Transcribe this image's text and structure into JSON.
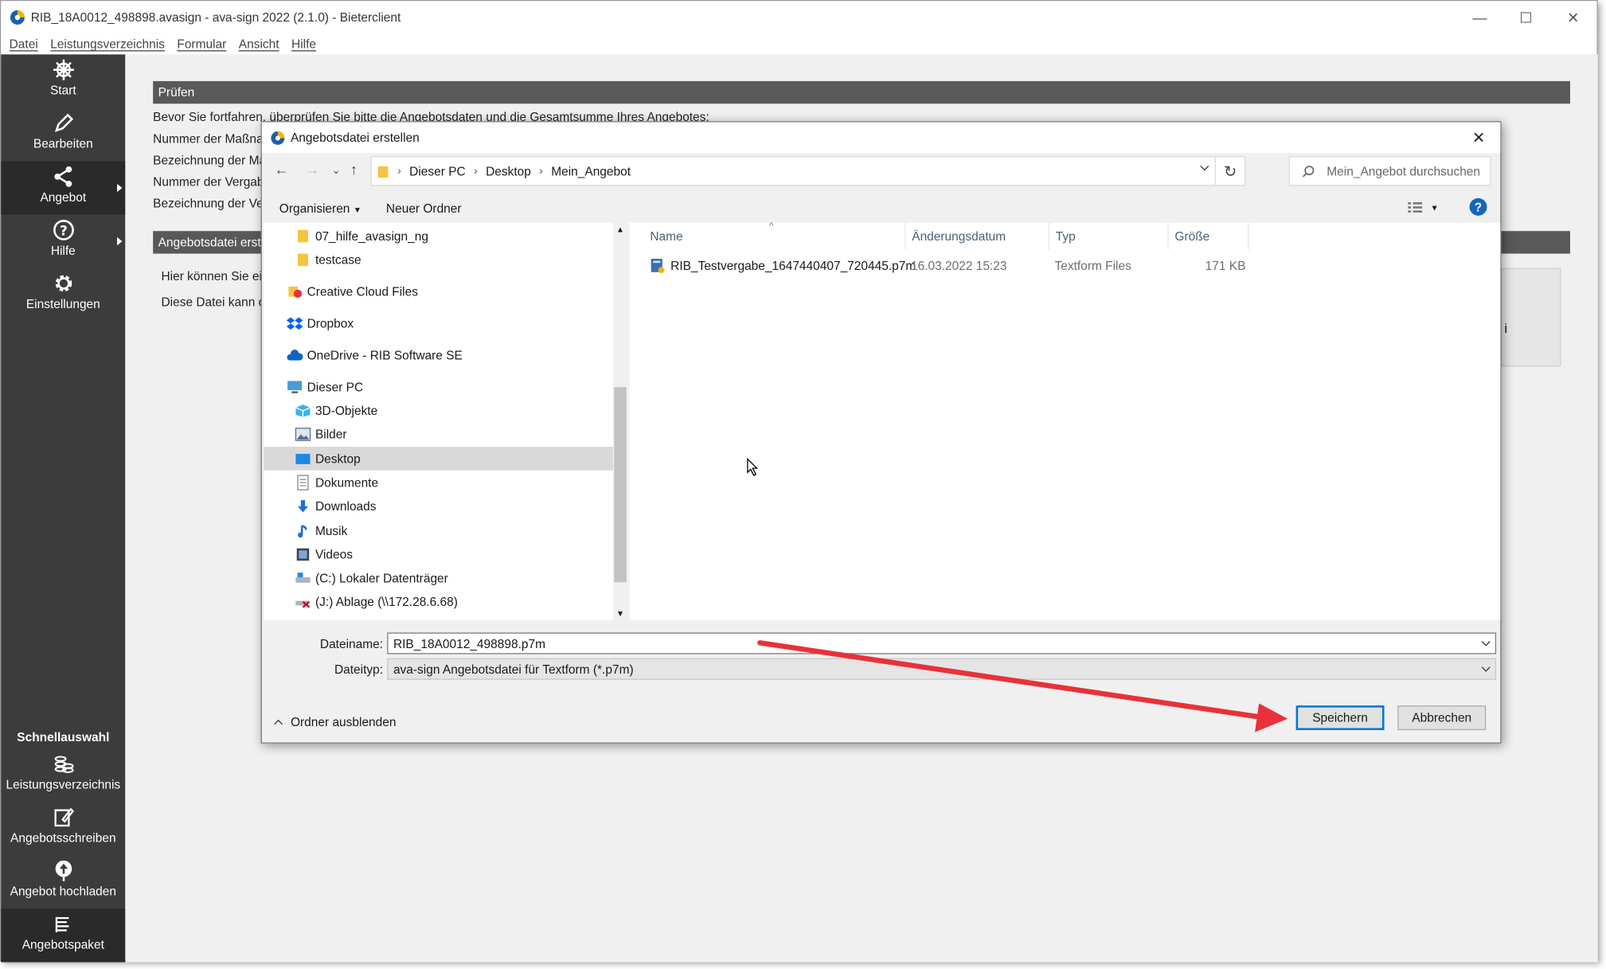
{
  "window": {
    "title": "RIB_18A0012_498898.avasign - ava-sign 2022 (2.1.0) - Bieterclient",
    "minimize": "—",
    "maximize": "☐",
    "close": "✕"
  },
  "menu": [
    "Datei",
    "Leistungsverzeichnis",
    "Formular",
    "Ansicht",
    "Hilfe"
  ],
  "sidebar": {
    "items": [
      {
        "label": "Start",
        "icon": "helm-icon"
      },
      {
        "label": "Bearbeiten",
        "icon": "pencil-icon"
      },
      {
        "label": "Angebot",
        "icon": "share-icon"
      },
      {
        "label": "Hilfe",
        "icon": "question-icon"
      },
      {
        "label": "Einstellungen",
        "icon": "gear-icon"
      }
    ],
    "quick_title": "Schnellauswahl",
    "quick_items": [
      {
        "label": "Leistungsverzeichnis",
        "icon": "coins-icon"
      },
      {
        "label": "Angebotsschreiben",
        "icon": "edit-document-icon"
      },
      {
        "label": "Angebot hochladen",
        "icon": "upload-icon"
      },
      {
        "label": "Angebotspaket",
        "icon": "package-list-icon"
      }
    ]
  },
  "content": {
    "section1_title": "Prüfen",
    "line1": "Bevor Sie fortfahren, überprüfen Sie bitte die Angebotsdaten und die Gesamtsumme Ihres Angebotes:",
    "line2": "Nummer der Maßnal",
    "line3": "Bezeichnung der Ma",
    "line4": "Nummer der Vergab",
    "line5": "Bezeichnung der Ver",
    "section2_title": "Angebotsdatei erste",
    "line6": "Hier können Sie ein",
    "line7": "Diese Datei kann d",
    "rbox_text": "i"
  },
  "dialog": {
    "title": "Angebotsdatei erstellen",
    "close": "✕",
    "path": [
      "Dieser PC",
      "Desktop",
      "Mein_Angebot"
    ],
    "search_placeholder": "Mein_Angebot durchsuchen",
    "organize": "Organisieren",
    "new_folder": "Neuer Ordner",
    "tree": [
      {
        "label": "07_hilfe_avasign_ng",
        "icon": "folder-icon",
        "indent": 2
      },
      {
        "label": "testcase",
        "icon": "folder-icon",
        "indent": 2
      },
      {
        "label": "Creative Cloud Files",
        "icon": "creative-cloud-icon",
        "indent": 1
      },
      {
        "label": "Dropbox",
        "icon": "dropbox-icon",
        "indent": 1
      },
      {
        "label": "OneDrive - RIB Software SE",
        "icon": "onedrive-icon",
        "indent": 1
      },
      {
        "label": "Dieser PC",
        "icon": "computer-icon",
        "indent": 1
      },
      {
        "label": "3D-Objekte",
        "icon": "cube-icon",
        "indent": 2
      },
      {
        "label": "Bilder",
        "icon": "pictures-icon",
        "indent": 2
      },
      {
        "label": "Desktop",
        "icon": "desktop-icon",
        "indent": 2,
        "selected": true
      },
      {
        "label": "Dokumente",
        "icon": "documents-icon",
        "indent": 2
      },
      {
        "label": "Downloads",
        "icon": "download-icon",
        "indent": 2
      },
      {
        "label": "Musik",
        "icon": "music-icon",
        "indent": 2
      },
      {
        "label": "Videos",
        "icon": "video-icon",
        "indent": 2
      },
      {
        "label": "(C:) Lokaler Datenträger",
        "icon": "drive-icon",
        "indent": 2
      },
      {
        "label": "(J:) Ablage (\\\\172.28.6.68)",
        "icon": "network-drive-icon",
        "indent": 2
      }
    ],
    "columns": [
      "Name",
      "Änderungsdatum",
      "Typ",
      "Größe"
    ],
    "files": [
      {
        "name": "RIB_Testvergabe_1647440407_720445.p7m",
        "date": "16.03.2022 15:23",
        "type": "Textform Files",
        "size": "171 KB"
      }
    ],
    "filename_label": "Dateiname:",
    "filename_value": "RIB_18A0012_498898.p7m",
    "filetype_label": "Dateityp:",
    "filetype_value": "ava-sign Angebotsdatei für Textform (*.p7m)",
    "hide_folders": "Ordner ausblenden",
    "save": "Speichern",
    "cancel": "Abbrechen"
  },
  "colors": {
    "annotation_arrow": "#e8313a",
    "accent": "#0078d7",
    "sidebar": "#3c3c3c"
  }
}
